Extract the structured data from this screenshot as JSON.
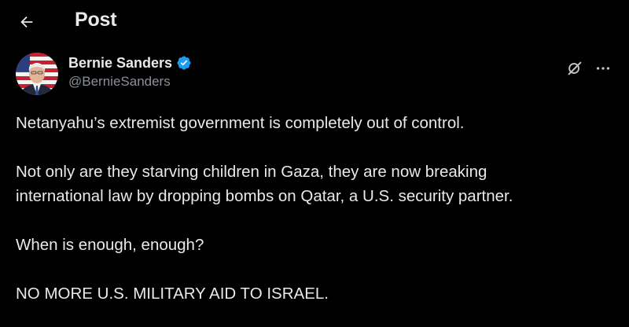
{
  "header": {
    "back_icon": "arrow-left-icon",
    "title": "Post"
  },
  "author": {
    "display_name": "Bernie Sanders",
    "handle": "@BernieSanders",
    "verified": true,
    "verified_color": "#1d9bf0",
    "avatar_icon": "profile-photo"
  },
  "actions": {
    "grok_icon": "grok-icon",
    "more_icon": "more-dots-icon"
  },
  "tweet": {
    "paragraphs": [
      "Netanyahu’s extremist government is completely out of control.",
      "Not only are they starving children in Gaza, they are now breaking\ninternational law by dropping bombs on Qatar, a U.S. security partner.",
      "When is enough, enough?",
      "NO MORE U.S. MILITARY AID TO ISRAEL."
    ]
  },
  "colors": {
    "background": "#000000",
    "text": "#e7e9ea",
    "secondary_text": "#8b9096"
  }
}
